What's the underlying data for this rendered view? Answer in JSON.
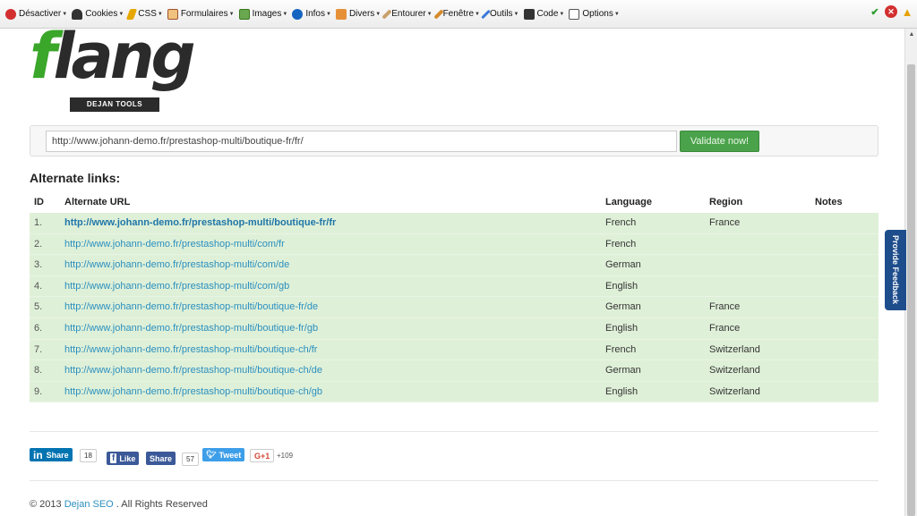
{
  "toolbar": {
    "items": [
      {
        "label": "Désactiver",
        "icon": "disable-icon"
      },
      {
        "label": "Cookies",
        "icon": "cookies-icon"
      },
      {
        "label": "CSS",
        "icon": "css-icon"
      },
      {
        "label": "Formulaires",
        "icon": "forms-icon"
      },
      {
        "label": "Images",
        "icon": "images-icon"
      },
      {
        "label": "Infos",
        "icon": "info-icon"
      },
      {
        "label": "Divers",
        "icon": "misc-icon"
      },
      {
        "label": "Entourer",
        "icon": "outline-icon"
      },
      {
        "label": "Fenêtre",
        "icon": "window-icon"
      },
      {
        "label": "Outils",
        "icon": "tools-icon"
      },
      {
        "label": "Code",
        "icon": "code-icon"
      },
      {
        "label": "Options",
        "icon": "options-icon"
      }
    ],
    "status_icons": [
      "checkmark-icon",
      "error-icon",
      "warning-icon"
    ]
  },
  "logo": {
    "brand": "flang",
    "brand_first": "f",
    "brand_rest": "lang",
    "badge": "DEJAN TOOLS"
  },
  "search": {
    "url_value": "http://www.johann-demo.fr/prestashop-multi/boutique-fr/fr/",
    "button_label": "Validate now!"
  },
  "results": {
    "title": "Alternate links:",
    "columns": {
      "id": "ID",
      "url": "Alternate URL",
      "language": "Language",
      "region": "Region",
      "notes": "Notes"
    },
    "rows": [
      {
        "id": "1.",
        "url": "http://www.johann-demo.fr/prestashop-multi/boutique-fr/fr",
        "language": "French",
        "region": "France",
        "notes": "",
        "current": true
      },
      {
        "id": "2.",
        "url": "http://www.johann-demo.fr/prestashop-multi/com/fr",
        "language": "French",
        "region": "",
        "notes": ""
      },
      {
        "id": "3.",
        "url": "http://www.johann-demo.fr/prestashop-multi/com/de",
        "language": "German",
        "region": "",
        "notes": ""
      },
      {
        "id": "4.",
        "url": "http://www.johann-demo.fr/prestashop-multi/com/gb",
        "language": "English",
        "region": "",
        "notes": ""
      },
      {
        "id": "5.",
        "url": "http://www.johann-demo.fr/prestashop-multi/boutique-fr/de",
        "language": "German",
        "region": "France",
        "notes": ""
      },
      {
        "id": "6.",
        "url": "http://www.johann-demo.fr/prestashop-multi/boutique-fr/gb",
        "language": "English",
        "region": "France",
        "notes": ""
      },
      {
        "id": "7.",
        "url": "http://www.johann-demo.fr/prestashop-multi/boutique-ch/fr",
        "language": "French",
        "region": "Switzerland",
        "notes": ""
      },
      {
        "id": "8.",
        "url": "http://www.johann-demo.fr/prestashop-multi/boutique-ch/de",
        "language": "German",
        "region": "Switzerland",
        "notes": ""
      },
      {
        "id": "9.",
        "url": "http://www.johann-demo.fr/prestashop-multi/boutique-ch/gb",
        "language": "English",
        "region": "Switzerland",
        "notes": ""
      }
    ]
  },
  "social": {
    "linkedin_label": "Share",
    "linkedin_brand": "in",
    "linkedin_count": "18",
    "facebook_like": "Like",
    "facebook_share": "Share",
    "facebook_count": "57",
    "tweet_label": "Tweet",
    "gplus_label": "G+1",
    "gplus_count": "+109"
  },
  "feedback": {
    "label": "Provide Feedback"
  },
  "footer": {
    "prefix": "© 2013",
    "link": "Dejan SEO",
    "suffix": ". All Rights Reserved"
  },
  "colors": {
    "accent_green": "#4aa24a",
    "row_bg": "#dff0d8",
    "link": "#2a8fbf",
    "logo_green": "#3aa62a"
  }
}
